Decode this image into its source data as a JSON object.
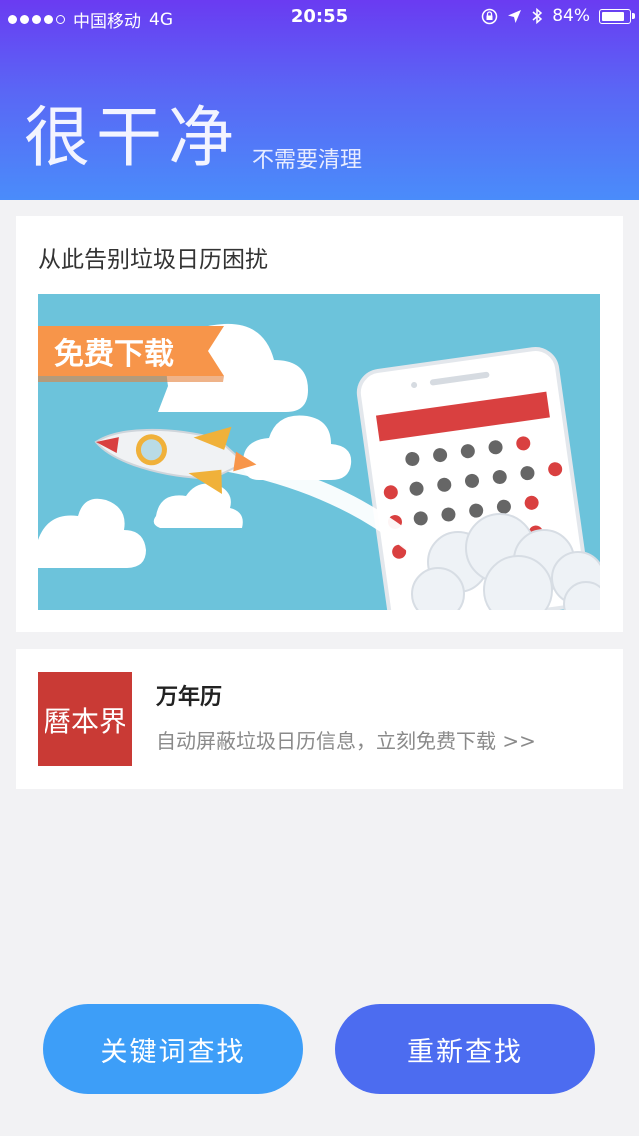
{
  "status_bar": {
    "carrier": "中国移动",
    "network": "4G",
    "time": "20:55",
    "battery_percent": "84%",
    "battery_level": 0.84,
    "signal_bars_filled": 4,
    "signal_bars_total": 5
  },
  "header": {
    "title": "很干净",
    "subtitle": "不需要清理"
  },
  "promo": {
    "title": "从此告别垃圾日历困扰",
    "ribbon_label": "免费下载"
  },
  "app": {
    "logo_text": "曆本界",
    "name": "万年历",
    "description": "自动屏蔽垃圾日历信息，立刻免费下载 >>"
  },
  "buttons": {
    "keyword_search": "关键词查找",
    "rescan": "重新查找"
  },
  "colors": {
    "header_top": "#6a3bf2",
    "header_bottom": "#4a8cfa",
    "banner_bg": "#6cc3db",
    "ribbon": "#f7954a",
    "calendar_red": "#d94040",
    "logo_bg": "#c93a35",
    "button_left": "#3d9ef8",
    "button_right": "#4c6cf0"
  }
}
